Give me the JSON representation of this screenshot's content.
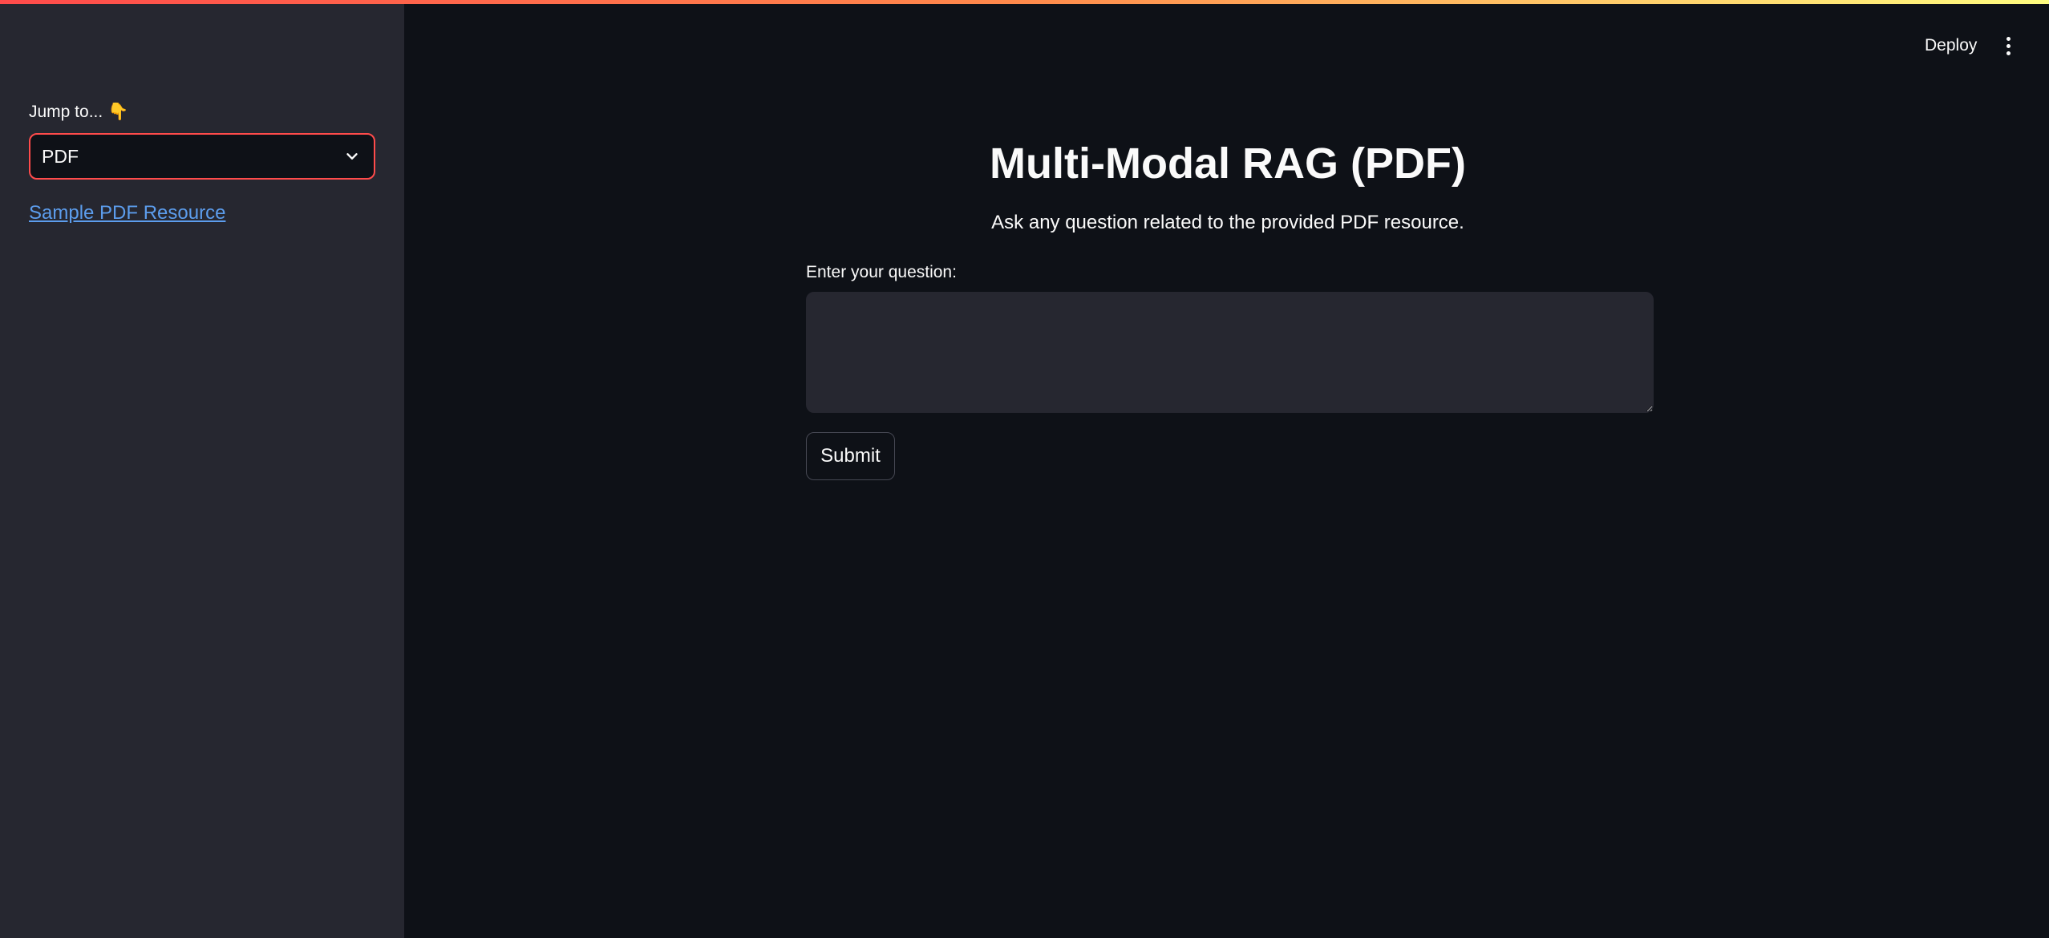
{
  "sidebar": {
    "label": "Jump to... 👇",
    "select_value": "PDF",
    "link_text": "Sample PDF Resource"
  },
  "header": {
    "deploy_label": "Deploy",
    "menu_icon": "kebab-menu-icon"
  },
  "main": {
    "title": "Multi-Modal RAG (PDF)",
    "subtitle": "Ask any question related to the provided PDF resource.",
    "question_label": "Enter your question:",
    "question_value": "",
    "submit_label": "Submit"
  },
  "colors": {
    "background": "#0e1117",
    "sidebar": "#262730",
    "accent": "#ff4b4b",
    "link": "#5c9ded"
  }
}
